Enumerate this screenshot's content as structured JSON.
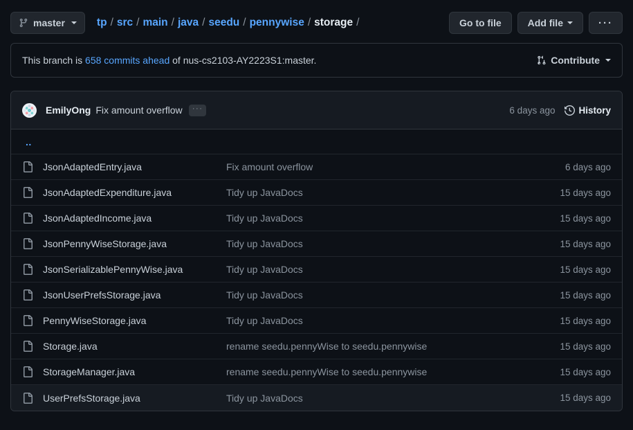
{
  "toolbar": {
    "branch_button": {
      "label": "master",
      "icon": "git-branch-icon"
    },
    "breadcrumb": {
      "crumbs": [
        {
          "label": "tp",
          "current": false
        },
        {
          "label": "src",
          "current": false
        },
        {
          "label": "main",
          "current": false
        },
        {
          "label": "java",
          "current": false
        },
        {
          "label": "seedu",
          "current": false
        },
        {
          "label": "pennywise",
          "current": false
        },
        {
          "label": "storage",
          "current": true
        }
      ],
      "separator": "/",
      "trailing_separator": "/"
    },
    "go_to_file_label": "Go to file",
    "add_file_label": "Add file",
    "kebab_label": "···"
  },
  "notice": {
    "prefix": "This branch is ",
    "link": "658 commits ahead",
    "suffix": " of nus-cs2103-AY2223S1:master.",
    "contribute_label": "Contribute",
    "contribute_icon": "git-pull-request-icon"
  },
  "commit_header": {
    "author": "EmilyOng",
    "message": "Fix amount overflow",
    "ellipsis_badge": "···",
    "date": "6 days ago",
    "history_label": "History",
    "history_icon": "history-clock-icon",
    "avatar": "user-avatar"
  },
  "file_table": {
    "parent_link": "..",
    "rows": [
      {
        "icon": "file-icon",
        "name": "JsonAdaptedEntry.java",
        "message": "Fix amount overflow",
        "date": "6 days ago",
        "hovered": false
      },
      {
        "icon": "file-icon",
        "name": "JsonAdaptedExpenditure.java",
        "message": "Tidy up JavaDocs",
        "date": "15 days ago",
        "hovered": false
      },
      {
        "icon": "file-icon",
        "name": "JsonAdaptedIncome.java",
        "message": "Tidy up JavaDocs",
        "date": "15 days ago",
        "hovered": false
      },
      {
        "icon": "file-icon",
        "name": "JsonPennyWiseStorage.java",
        "message": "Tidy up JavaDocs",
        "date": "15 days ago",
        "hovered": false
      },
      {
        "icon": "file-icon",
        "name": "JsonSerializablePennyWise.java",
        "message": "Tidy up JavaDocs",
        "date": "15 days ago",
        "hovered": false
      },
      {
        "icon": "file-icon",
        "name": "JsonUserPrefsStorage.java",
        "message": "Tidy up JavaDocs",
        "date": "15 days ago",
        "hovered": false
      },
      {
        "icon": "file-icon",
        "name": "PennyWiseStorage.java",
        "message": "Tidy up JavaDocs",
        "date": "15 days ago",
        "hovered": false
      },
      {
        "icon": "file-icon",
        "name": "Storage.java",
        "message": "rename seedu.pennyWise to seedu.pennywise",
        "date": "15 days ago",
        "hovered": false
      },
      {
        "icon": "file-icon",
        "name": "StorageManager.java",
        "message": "rename seedu.pennyWise to seedu.pennywise",
        "date": "15 days ago",
        "hovered": false
      },
      {
        "icon": "file-icon",
        "name": "UserPrefsStorage.java",
        "message": "Tidy up JavaDocs",
        "date": "15 days ago",
        "hovered": true
      }
    ]
  },
  "colors": {
    "page_bg": "#0d1117",
    "panel_bg": "#161b22",
    "border": "#30363d",
    "link": "#58a6ff",
    "text": "#c9d1d9",
    "muted": "#8b949e"
  }
}
